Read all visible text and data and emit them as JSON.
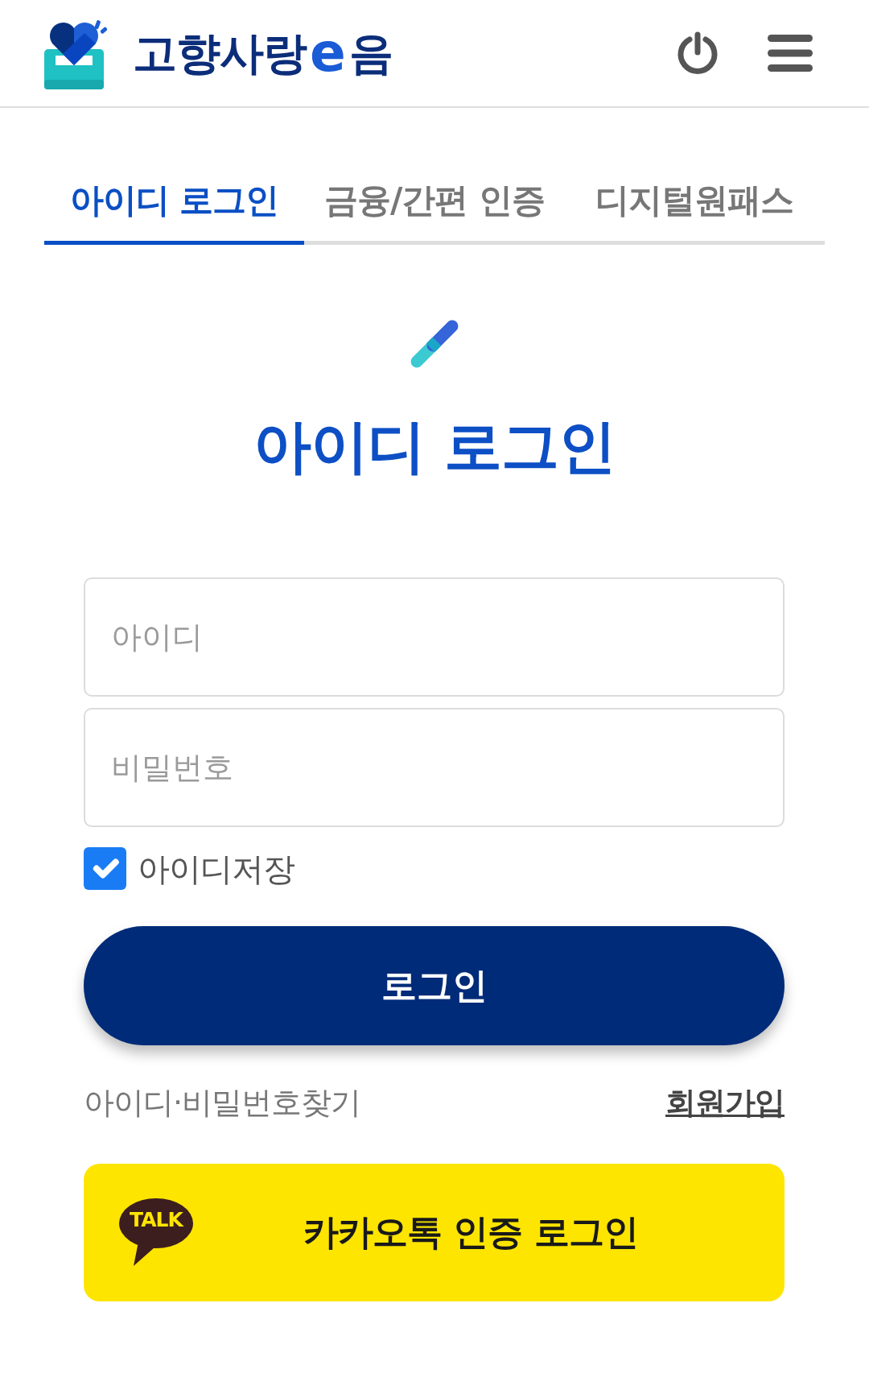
{
  "header": {
    "logo": {
      "text": "고향사랑",
      "mark": "e",
      "suffix": "음"
    }
  },
  "tabs": [
    {
      "label": "아이디 로그인",
      "selected": true
    },
    {
      "label": "금융/간편 인증",
      "selected": false
    },
    {
      "label": "디지털원패스",
      "selected": false
    }
  ],
  "title": "아이디 로그인",
  "form": {
    "fields": [
      {
        "placeholder": "아이디"
      },
      {
        "placeholder": "비밀번호"
      }
    ],
    "remember": {
      "label": "아이디저장",
      "checked": true
    },
    "submit": "로그인",
    "links": [
      {
        "kind": "plain",
        "label": "아이디·비밀번호찾기"
      },
      {
        "kind": "underlined",
        "label": "회원가입"
      }
    ]
  },
  "kakao": {
    "badge": "TALK",
    "label": "카카오톡 인증 로그인"
  }
}
